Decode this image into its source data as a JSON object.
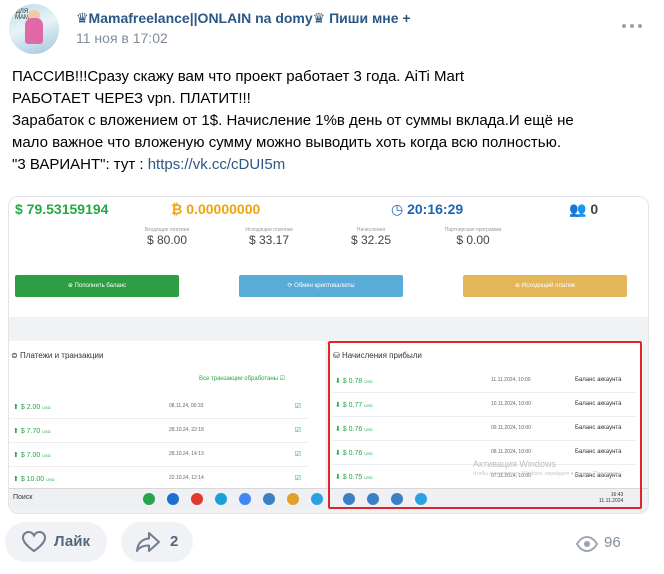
{
  "author": {
    "name": "♛Mamafreelance||ONLAIN na domy♛ Пиши мне +",
    "date": "11 ноя в 17:02",
    "avatar_text": "ДЛЯ МАМ"
  },
  "post": {
    "lines": [
      "ПАССИВ!!!Сразу скажу вам что проект работает 3 года. AiTi Mart",
      "РАБОТАЕТ ЧЕРЕЗ vpn. ПЛАТИТ!!!",
      "Зарабаток с вложением от 1$. Начисление 1%в день от суммы вклада.И ещё не",
      "мало важное что вложеную сумму можно выводить хоть когда всю полностью."
    ],
    "link_prefix": "\"3 ВАРИАНТ\": тут : ",
    "link": "https://vk.cc/cDUI5m"
  },
  "screenshot": {
    "balance_usd": "$ 79.53159194",
    "balance_btc": "₿ 0.00000000",
    "timer": "20:16:29",
    "referrals": "0",
    "stats": [
      {
        "label": "Входящие платежи",
        "value": "$ 80.00"
      },
      {
        "label": "Исходящие платежи",
        "value": "$ 33.17"
      },
      {
        "label": "Начисления",
        "value": "$ 32.25"
      },
      {
        "label": "Партнерская программа",
        "value": "$ 0.00"
      }
    ],
    "buttons": {
      "deposit": "Пополнить баланс",
      "exchange": "Обмен криптовалюты",
      "withdraw": "Исходящий платеж"
    },
    "payments_title": "Платежи и транзакции",
    "payments_all": "Все транзакции обработаны",
    "payments": [
      {
        "amount": "$ 2.00",
        "date": "08.11.24, 00:33"
      },
      {
        "amount": "$ 7.70",
        "date": "28.10.24, 22:18"
      },
      {
        "amount": "$ 7.00",
        "date": "28.10.24, 14:13"
      },
      {
        "amount": "$ 10.00",
        "date": "22.10.24, 12:14"
      }
    ],
    "accruals_title": "Начисления прибыли",
    "accruals": [
      {
        "amount": "$ 0.78",
        "date": "11.11.2024, 10:00",
        "desc": "Баланс аккаунта"
      },
      {
        "amount": "$ 0.77",
        "date": "10.11.2024, 10:00",
        "desc": "Баланс аккаунта"
      },
      {
        "amount": "$ 0.76",
        "date": "09.11.2024, 10:00",
        "desc": "Баланс аккаунта"
      },
      {
        "amount": "$ 0.76",
        "date": "08.11.2024, 10:00",
        "desc": "Баланс аккаунта"
      },
      {
        "amount": "$ 0.75",
        "date": "07.11.2024, 10:00",
        "desc": "Баланс аккаунта"
      }
    ],
    "usd": "USD",
    "watermark": "Активация Windows",
    "watermark_sub": "Чтобы активировать Windows, перейдите в раздел \"Параметры\".",
    "taskbar_search": "Поиск",
    "clock_time": "16:43",
    "clock_date": "11.11.2024"
  },
  "actions": {
    "like_label": "Лайк",
    "share_count": "2",
    "views": "96"
  },
  "colors": {
    "link": "#2a5885",
    "green": "#28a745",
    "red_box": "#e0242b",
    "deposit_btn": "#2e9e44",
    "exchange_btn": "#5aacd8",
    "withdraw_btn": "#e3b65a"
  }
}
